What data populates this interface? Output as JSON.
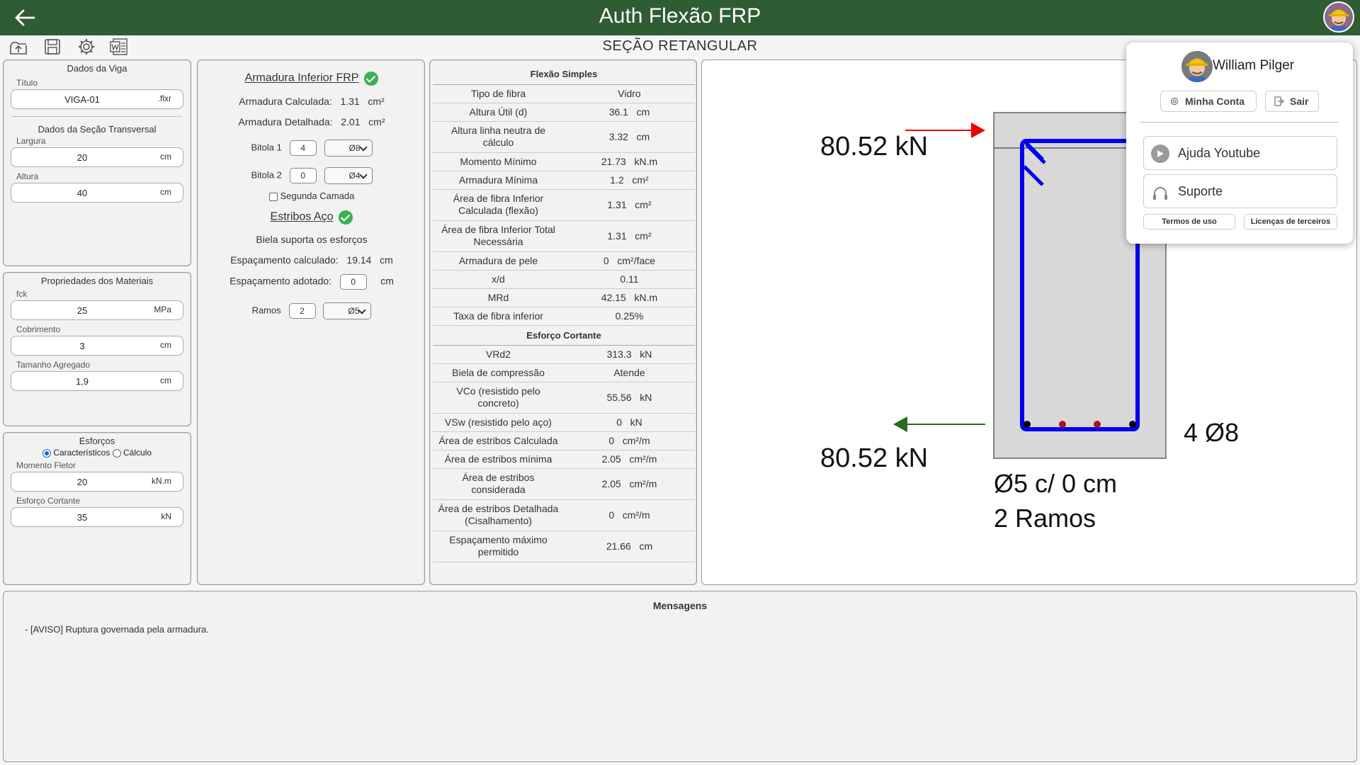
{
  "header": {
    "title": "Auth Flexão FRP",
    "subtitle": "SEÇÃO RETANGULAR"
  },
  "toolbar": {
    "icons": [
      "upload-icon",
      "save-icon",
      "gear-icon",
      "word-icon"
    ]
  },
  "dados_viga": {
    "heading": "Dados da Viga",
    "titulo_label": "Título",
    "titulo_value": "VIGA-01",
    "titulo_unit": ".flxr",
    "secao_heading": "Dados da Seção Transversal",
    "largura_label": "Largura",
    "largura_value": "20",
    "largura_unit": "cm",
    "altura_label": "Altura",
    "altura_value": "40",
    "altura_unit": "cm"
  },
  "materiais": {
    "heading": "Propriedades dos Materiais",
    "fck_label": "fck",
    "fck_value": "25",
    "fck_unit": "MPa",
    "cobrimento_label": "Cobrimento",
    "cobrimento_value": "3",
    "cobrimento_unit": "cm",
    "agregado_label": "Tamanho Agregado",
    "agregado_value": "1,9",
    "agregado_unit": "cm"
  },
  "esforcos": {
    "heading": "Esforços",
    "radio_caracteristicos": "Característicos",
    "radio_calculo": "Cálculo",
    "momento_label": "Momento Fletor",
    "momento_value": "20",
    "momento_unit": "kN.m",
    "cortante_label": "Esforço Cortante",
    "cortante_value": "35",
    "cortante_unit": "kN"
  },
  "armadura": {
    "heading": "Armadura Inferior FRP",
    "calculada_label": "Armadura Calculada:",
    "calculada_value": "1.31",
    "calculada_unit": "cm²",
    "detalhada_label": "Armadura Detalhada:",
    "detalhada_value": "2.01",
    "detalhada_unit": "cm²",
    "bitola1_label": "Bitola 1",
    "bitola1_qty": "4",
    "bitola1_diam": "Ø8",
    "bitola2_label": "Bitola 2",
    "bitola2_qty": "0",
    "bitola2_diam": "Ø4",
    "segunda_camada": "Segunda Camada",
    "estribos_heading": "Estribos Aço",
    "biela_text": "Biela suporta os esforços",
    "esp_calc_label": "Espaçamento calculado:",
    "esp_calc_value": "19.14",
    "esp_calc_unit": "cm",
    "esp_adot_label": "Espaçamento adotado:",
    "esp_adot_value": "0",
    "esp_adot_unit": "cm",
    "ramos_label": "Ramos",
    "ramos_value": "2",
    "ramos_diam": "Ø5"
  },
  "resultados": {
    "flexao_heading": "Flexão Simples",
    "flexao_rows": [
      {
        "label": "Tipo de fibra",
        "value": "Vidro"
      },
      {
        "label": "Altura Útil (d)",
        "value": "36.1   cm"
      },
      {
        "label": "Altura linha neutra de cálculo",
        "value": "3.32   cm"
      },
      {
        "label": "Momento Mínimo",
        "value": "21.73   kN.m"
      },
      {
        "label": "Armadura Mínima",
        "value": "1.2   cm²"
      },
      {
        "label": "Área de fibra Inferior Calculada (flexão)",
        "value": "1.31   cm²"
      },
      {
        "label": "Área de fibra Inferior Total Necessária",
        "value": "1.31   cm²"
      },
      {
        "label": "Armadura de pele",
        "value": "0   cm²/face"
      },
      {
        "label": "x/d",
        "value": "0.11"
      },
      {
        "label": "MRd",
        "value": "42.15   kN.m"
      },
      {
        "label": "Taxa de fibra inferior",
        "value": "0.25%"
      }
    ],
    "cortante_heading": "Esforço Cortante",
    "cortante_rows": [
      {
        "label": "VRd2",
        "value": "313.3   kN"
      },
      {
        "label": "Biela de compressão",
        "value": "Atende"
      },
      {
        "label": "VCo (resistido pelo concreto)",
        "value": "55.56   kN"
      },
      {
        "label": "VSw (resistido pelo aço)",
        "value": "0   kN"
      },
      {
        "label": "Área de estribos Calculada",
        "value": "0   cm²/m"
      },
      {
        "label": "Área de estribos mínima",
        "value": "2.05   cm²/m"
      },
      {
        "label": "Área de estribos considerada",
        "value": "2.05   cm²/m"
      },
      {
        "label": "Área de estribos Detalhada (Cisalhamento)",
        "value": "0   cm²/m"
      },
      {
        "label": "Espaçamento máximo permitido",
        "value": "21.66   cm"
      }
    ]
  },
  "desenho": {
    "force_top": "80.52 kN",
    "force_bottom": "80.52 kN",
    "bars_label": "4 Ø8",
    "stirrup_label": "Ø5 c/ 0 cm",
    "ramos_label": "2 Ramos",
    "colors": {
      "stirrup": "#0000ee",
      "top_arrow": "#ee0000",
      "bottom_arrow": "#2a6a1e",
      "bar_corner": "#000000",
      "bar_mid": "#b0102a",
      "concrete": "#d8d8d8"
    }
  },
  "mensagens": {
    "heading": "Mensagens",
    "items": [
      "- [AVISO] Ruptura governada pela armadura."
    ]
  },
  "user_menu": {
    "name": "William Pilger",
    "minha_conta": "Minha Conta",
    "sair": "Sair",
    "ajuda": "Ajuda Youtube",
    "suporte": "Suporte",
    "termos": "Termos de uso",
    "licencas": "Licenças de terceiros"
  },
  "colors": {
    "header_bg": "#2e5c33",
    "ok_green": "#3cb054"
  }
}
